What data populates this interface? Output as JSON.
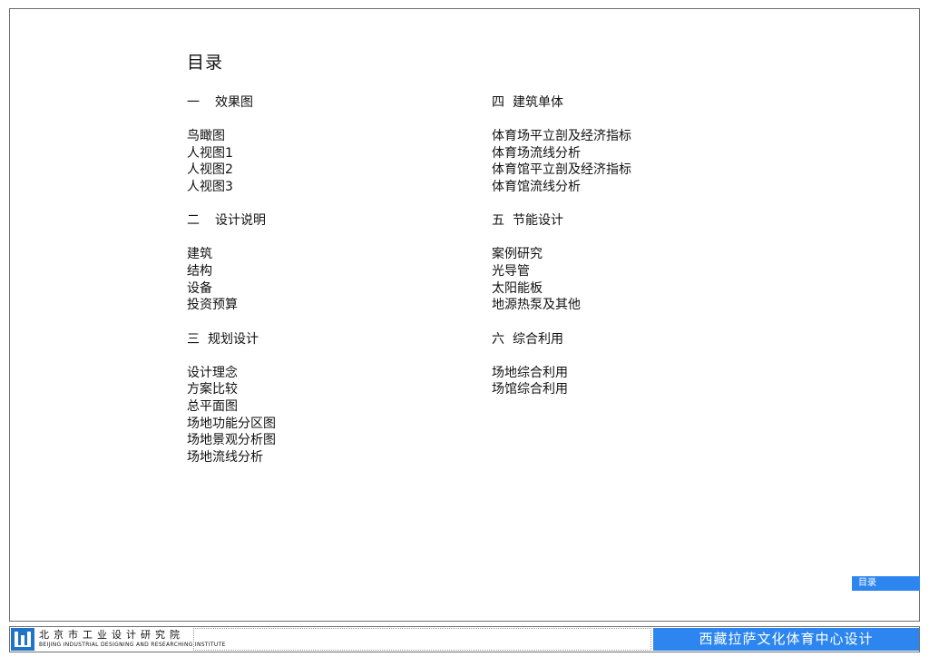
{
  "title": "目录",
  "sections_left": [
    {
      "num": "一",
      "title": "效果图",
      "items": [
        "鸟瞰图",
        "人视图1",
        "人视图2",
        "人视图3"
      ]
    },
    {
      "num": "二",
      "title": "设计说明",
      "items": [
        "建筑",
        "结构",
        "设备",
        "投资预算"
      ]
    },
    {
      "num": "三",
      "title": "规划设计",
      "items": [
        "设计理念",
        "方案比较",
        "总平面图",
        "场地功能分区图",
        "场地景观分析图",
        "场地流线分析"
      ]
    }
  ],
  "sections_right": [
    {
      "num": "四",
      "title": "建筑单体",
      "items": [
        "体育场平立剖及经济指标",
        "体育场流线分析",
        "体育馆平立剖及经济指标",
        "体育馆流线分析"
      ]
    },
    {
      "num": "五",
      "title": "节能设计",
      "items": [
        "案例研究",
        "光导管",
        "太阳能板",
        "地源热泵及其他"
      ]
    },
    {
      "num": "六",
      "title": "综合利用",
      "items": [
        "场地综合利用",
        "场馆综合利用"
      ]
    }
  ],
  "page_tag": "目录",
  "footer": {
    "org_cn": "北京市工业设计研究院",
    "org_en": "BEIJING INDUSTRIAL DESIGNING AND RESEARCHING INSTITUTE",
    "project": "西藏拉萨文化体育中心设计"
  },
  "colors": {
    "accent": "#2d86ef",
    "logo": "#1f73c8",
    "border": "#6f6f6f"
  },
  "icons": {
    "logo": "institute-logo-icon"
  }
}
